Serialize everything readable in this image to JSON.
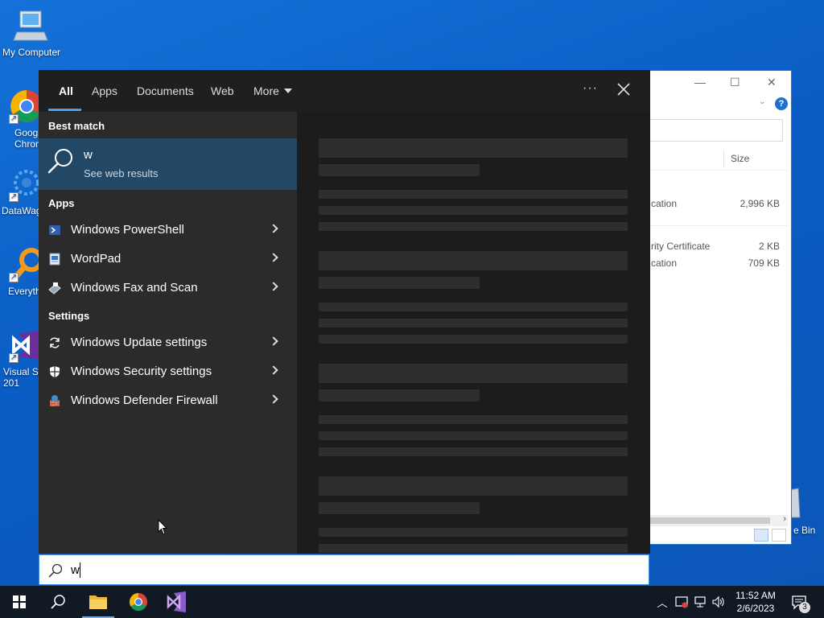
{
  "desktop": {
    "icons": [
      {
        "label": "My Computer",
        "icon": "computer-icon"
      },
      {
        "label": "Goog\nChron",
        "icon": "chrome-icon"
      },
      {
        "label": "DataWag",
        "icon": "datawag-icon"
      },
      {
        "label": "Everyth",
        "icon": "everything-icon"
      },
      {
        "label": "Visual St\n201",
        "icon": "visual-studio-icon"
      }
    ],
    "recycle_bin_label": "e Bin"
  },
  "explorer": {
    "column_size": "Size",
    "rows": [
      {
        "type": "cation",
        "size": "2,996 KB"
      },
      {
        "type": "rity Certificate",
        "size": "2 KB"
      },
      {
        "type": "cation",
        "size": "709 KB"
      }
    ]
  },
  "search": {
    "tabs": [
      "All",
      "Apps",
      "Documents",
      "Web",
      "More"
    ],
    "active_tab": "All",
    "best_match_header": "Best match",
    "best_match": {
      "title": "w",
      "subtitle": "See web results"
    },
    "apps_header": "Apps",
    "apps": [
      {
        "label": "Windows PowerShell",
        "icon": "powershell-icon"
      },
      {
        "label": "WordPad",
        "icon": "wordpad-icon"
      },
      {
        "label": "Windows Fax and Scan",
        "icon": "fax-scan-icon"
      }
    ],
    "settings_header": "Settings",
    "settings": [
      {
        "label": "Windows Update settings",
        "icon": "update-sync-icon"
      },
      {
        "label": "Windows Security settings",
        "icon": "shield-icon"
      },
      {
        "label": "Windows Defender Firewall",
        "icon": "firewall-icon"
      }
    ],
    "query": "w"
  },
  "taskbar": {
    "pinned": [
      "start-icon",
      "search-icon",
      "file-explorer-icon",
      "chrome-icon",
      "visual-studio-icon"
    ],
    "clock_time": "11:52 AM",
    "clock_date": "2/6/2023",
    "notification_count": "3"
  },
  "colors": {
    "accent": "#4aa0e6",
    "best_match_bg": "#224866",
    "panel_bg": "#2b2b2b"
  }
}
